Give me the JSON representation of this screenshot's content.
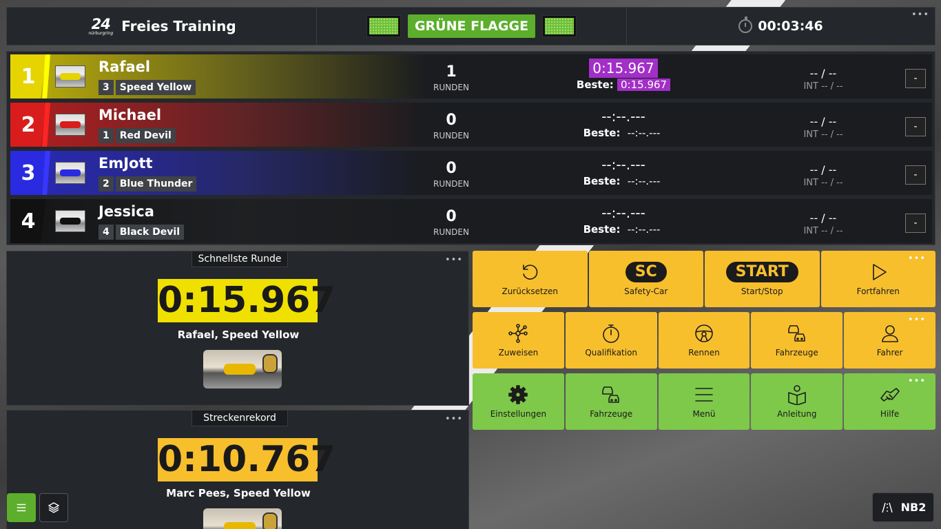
{
  "header": {
    "logo_big": "24",
    "logo_small": "nürburgring",
    "session_title": "Freies Training",
    "flag_label": "GRÜNE FLAGGE",
    "timer": "00:03:46"
  },
  "board": {
    "runden_label": "RUNDEN",
    "beste_label": "Beste:",
    "rows": [
      {
        "pos": "1",
        "driver": "Rafael",
        "car_no": "3",
        "car": "Speed Yellow",
        "laps": "1",
        "last": "0:15.967",
        "best": "0:15.967",
        "gap": "-- / --",
        "int": "INT -- / --",
        "button": "-",
        "color": "#e6d400"
      },
      {
        "pos": "2",
        "driver": "Michael",
        "car_no": "1",
        "car": "Red Devil",
        "laps": "0",
        "last": "--:--.---",
        "best": "--:--.---",
        "gap": "-- / --",
        "int": "INT -- / --",
        "button": "-",
        "color": "#d91c1c"
      },
      {
        "pos": "3",
        "driver": "EmJott",
        "car_no": "2",
        "car": "Blue Thunder",
        "laps": "0",
        "last": "--:--.---",
        "best": "--:--.---",
        "gap": "-- / --",
        "int": "INT -- / --",
        "button": "-",
        "color": "#2a2ae0"
      },
      {
        "pos": "4",
        "driver": "Jessica",
        "car_no": "4",
        "car": "Black Devil",
        "laps": "0",
        "last": "--:--.---",
        "best": "--:--.---",
        "gap": "-- / --",
        "int": "INT -- / --",
        "button": "-",
        "color": "#111111"
      }
    ]
  },
  "fastest": {
    "label": "Schnellste Runde",
    "time": "0:15.967",
    "who": "Rafael, Speed Yellow",
    "time_bg": "#f0e000"
  },
  "record": {
    "label": "Streckenrekord",
    "time": "0:10.767",
    "who": "Marc Pees, Speed Yellow",
    "time_bg": "#f8bf2d"
  },
  "race_controls": [
    {
      "label": "Zurücksetzen",
      "icon": "reset-icon"
    },
    {
      "label": "Safety-Car",
      "pill": "SC"
    },
    {
      "label": "Start/Stop",
      "pill": "START"
    },
    {
      "label": "Fortfahren",
      "icon": "play-icon"
    }
  ],
  "mode_controls": [
    {
      "label": "Zuweisen",
      "icon": "network-icon"
    },
    {
      "label": "Qualifikation",
      "icon": "stopwatch-icon"
    },
    {
      "label": "Rennen",
      "icon": "steering-wheel-icon"
    },
    {
      "label": "Fahrzeuge",
      "icon": "cars-icon"
    },
    {
      "label": "Fahrer",
      "icon": "person-icon"
    }
  ],
  "settings_controls": [
    {
      "label": "Einstellungen",
      "icon": "gear-icon"
    },
    {
      "label": "Fahrzeuge",
      "icon": "cars-icon"
    },
    {
      "label": "Menü",
      "icon": "menu-icon"
    },
    {
      "label": "Anleitung",
      "icon": "guide-icon"
    },
    {
      "label": "Hilfe",
      "icon": "handshake-icon"
    }
  ],
  "track_badge": "NB2",
  "colors": {
    "yellow": "#f8bf2d",
    "green": "#7ec94a",
    "purple": "#a22fc7",
    "flag_green": "#5cae2c"
  }
}
